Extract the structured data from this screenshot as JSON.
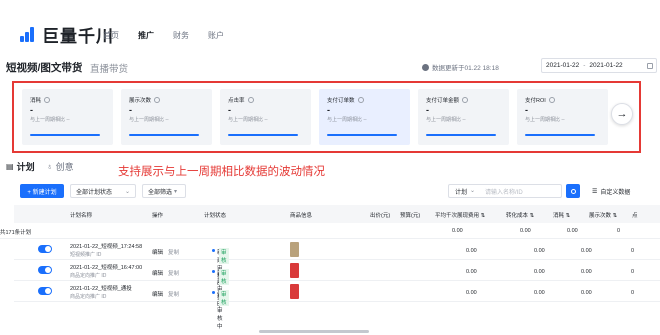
{
  "brand": {
    "name": "巨量千川"
  },
  "nav": {
    "items": [
      "首页",
      "推广",
      "财务",
      "账户"
    ],
    "active_index": 1
  },
  "page": {
    "title": "短视频/图文带货",
    "subtitle": "直播带货",
    "update_info": "数据更新于01.22 18:18",
    "date_start": "2021-01-22",
    "date_sep": "-",
    "date_end": "2021-01-22"
  },
  "metrics": [
    {
      "name": "消耗",
      "value": "-",
      "compare": "与上一周期相比 --",
      "highlight": false
    },
    {
      "name": "展示次数",
      "value": "-",
      "compare": "与上一周期相比 --",
      "highlight": false
    },
    {
      "name": "点击率",
      "value": "-",
      "compare": "与上一周期相比 --",
      "highlight": false
    },
    {
      "name": "支付订单数",
      "value": "-",
      "compare": "与上一周期相比 --",
      "highlight": true
    },
    {
      "name": "支付订单金额",
      "value": "-",
      "compare": "与上一周期相比 --",
      "highlight": false
    },
    {
      "name": "支付ROI",
      "value": "-",
      "compare": "与上一周期相比 --",
      "highlight": false
    }
  ],
  "tabs": [
    {
      "label": "计划",
      "icon": "list-icon",
      "active": true
    },
    {
      "label": "创意",
      "icon": "bulb-icon",
      "active": false
    }
  ],
  "annotation": "支持展示与上一周期相比数据的波动情况",
  "toolbar": {
    "new_plan": "+ 新建计划",
    "status_select": "全部计划状态",
    "filter": "全部筛选",
    "search_scope": "计划",
    "search_placeholder": "请输入名称/ID",
    "custom_data": "自定义数据"
  },
  "table": {
    "headers": [
      "计划名称",
      "操作",
      "计划状态",
      "商品信息",
      "出价(元)",
      "预算(元)",
      "平均千次展现费用 ⇅",
      "转化成本 ⇅",
      "消耗 ⇅",
      "展示次数 ⇅",
      "点"
    ],
    "summary_label": "共171条计划",
    "summary_values": [
      "0.00",
      "0.00",
      "0.00",
      "0"
    ],
    "rows": [
      {
        "name": "2021-01-22_短视频_17:24:58",
        "sub": "短视频推广 ID",
        "edit": "编辑",
        "copy": "复制",
        "status": "新建审核中",
        "tag": "审核",
        "thumb_color": "#b9a27c",
        "values": [
          "0.00",
          "0.00",
          "0.00",
          "0"
        ]
      },
      {
        "name": "2021-01-22_短视频_16:47:00",
        "sub": "商品定向推广 ID",
        "edit": "编辑",
        "copy": "复制",
        "status": "新建审核中",
        "tag": "审核",
        "thumb_color": "#d93a3a",
        "values": [
          "0.00",
          "0.00",
          "0.00",
          "0"
        ]
      },
      {
        "name": "2021-01-22_短视频_通投",
        "sub": "商品定向推广 ID",
        "edit": "编辑",
        "copy": "复制",
        "status": "修改审核中",
        "tag": "审核",
        "thumb_color": "#d93a3a",
        "values": [
          "0.00",
          "0.00",
          "0.00",
          "0"
        ]
      }
    ]
  },
  "colors": {
    "accent": "#1a6ffc",
    "annotation": "#e53935",
    "highlight_card": "#e9efff"
  }
}
